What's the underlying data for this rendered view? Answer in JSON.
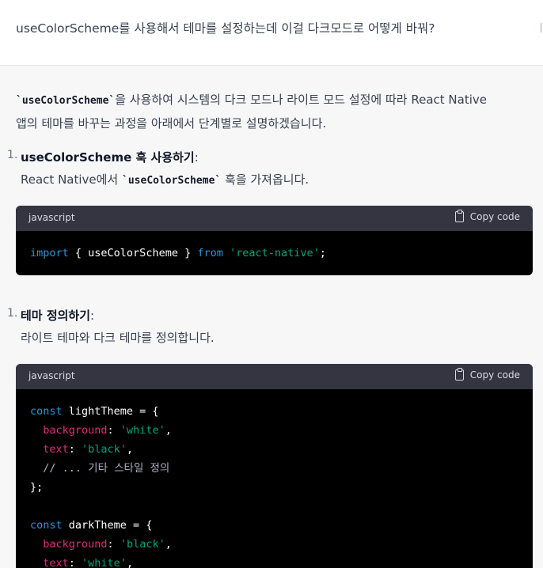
{
  "user_message": {
    "text": "useColorScheme를 사용해서 테마를 설정하는데 이걸 다크모드로 어떻게 바꿔?"
  },
  "assistant": {
    "intro_line1_code": "`useColorScheme`",
    "intro_line1_rest": "을 사용하여 시스템의 다크 모드나 라이트 모드 설정에 따라 React Native",
    "intro_line2": "앱의 테마를 바꾸는 과정을 아래에서 단계별로 설명하겠습니다.",
    "steps": [
      {
        "number": "1.",
        "title": "useColorScheme 훅 사용하기",
        "colon": ":",
        "desc_before": "React Native에서 ",
        "desc_code": "`useColorScheme`",
        "desc_after": " 훅을 가져옵니다."
      },
      {
        "number": "1.",
        "title": "테마 정의하기",
        "colon": ":",
        "desc": "라이트 테마와 다크 테마를 정의합니다."
      }
    ],
    "code_blocks": [
      {
        "language": "javascript",
        "copy_label": "Copy code",
        "tokens": {
          "import_kw": "import",
          "brace_open": " { useColorScheme } ",
          "from_kw": "from",
          "module": "'react-native'",
          "semicolon": ";"
        }
      },
      {
        "language": "javascript",
        "copy_label": "Copy code",
        "tokens": {
          "const1": "const",
          "light_decl": " lightTheme = {",
          "bg_key": "background",
          "white_str": "'white'",
          "text_key": "text",
          "black_str": "'black'",
          "comment": "// ... 기타 스타일 정의",
          "close": "};",
          "const2": "const",
          "dark_decl": " darkTheme = {",
          "bg_key2": "background",
          "black_str2": "'black'",
          "text_key2": "text",
          "white_str2": "'white'"
        }
      }
    ]
  }
}
